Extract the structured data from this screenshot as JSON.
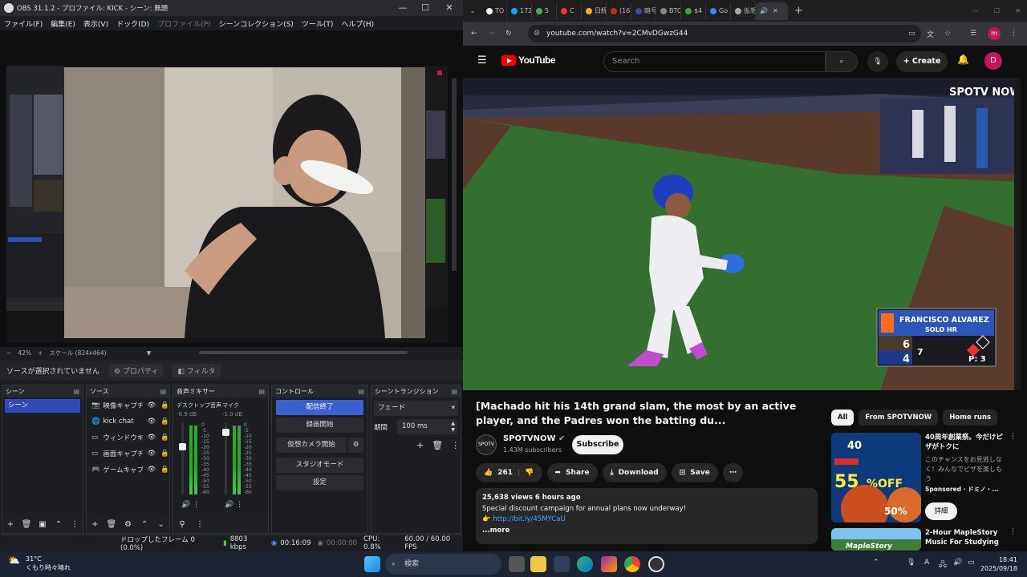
{
  "obs": {
    "title": "OBS 31.1.2 - プロファイル: KICK - シーン: 無題",
    "menu": [
      "ファイル(F)",
      "編集(E)",
      "表示(V)",
      "ドック(D)",
      "プロファイル(P)",
      "シーンコレクション(S)",
      "ツール(T)",
      "ヘルプ(H)"
    ],
    "zoom": "42%",
    "scale": "スケール (824x464)",
    "no_source": "ソースが選択されていません",
    "properties": "プロパティ",
    "filters": "フィルタ",
    "docks": {
      "scenes": "シーン",
      "sources": "ソース",
      "mixer": "音声ミキサー",
      "controls": "コントロール",
      "transitions": "シーントランジション"
    },
    "scene_items": [
      "シーン"
    ],
    "sources": [
      "映像キャプチ",
      "kick chat",
      "ウィンドウキャ",
      "画面キャプチ",
      "ゲームキャプチ"
    ],
    "mixer": [
      {
        "name": "デスクトップ音声",
        "db": "-8.9 dB"
      },
      {
        "name": "マイク",
        "db": "-1.0 dB"
      }
    ],
    "meter_ticks": [
      "0",
      "-5",
      "-10",
      "-15",
      "-20",
      "-25",
      "-30",
      "-35",
      "-40",
      "-45",
      "-50",
      "-55",
      "-60"
    ],
    "controls": [
      "配信終了",
      "録画開始",
      "仮想カメラ開始",
      "スタジオモード",
      "設定"
    ],
    "transition": "フェード",
    "duration_label": "期間",
    "duration": "100 ms",
    "status": {
      "dropped": "ドロップしたフレーム 0 (0.0%)",
      "kbps": "8803 kbps",
      "live": "00:16:09",
      "rec": "00:00:00",
      "cpu": "CPU: 0.8%",
      "fps": "60.00 / 60.00 FPS"
    }
  },
  "chrome": {
    "tabs": [
      "TO",
      "172",
      "5",
      "C",
      "日経",
      "(16",
      "暗号",
      "BTC",
      "$4",
      "Go",
      "仮想",
      ""
    ],
    "url": "youtube.com/watch?v=2CMvDGwzG44",
    "profile": "m"
  },
  "youtube": {
    "logo": "YouTube",
    "search_placeholder": "Search",
    "create": "Create",
    "avatar": "D",
    "title": "[Machado hit his 14th grand slam, the most by an active player, and the Padres won the batting du...",
    "channel": "SPOTVNOW",
    "subs": "1.43M subscribers",
    "subscribe": "Subscribe",
    "likes": "261",
    "share": "Share",
    "download": "Download",
    "save": "Save",
    "desc_stats": "25,638 views  6 hours ago",
    "desc_line": "Special discount campaign for annual plans now underway!",
    "desc_link": "http://bit.ly/45MYCaU",
    "more": "...more",
    "chips": [
      "All",
      "From SPOTVNOW",
      "Home runs"
    ],
    "rec1": {
      "title": "40周年創業祭。今だけピザがトクに",
      "desc": "このチャンスをお見逃しなく！みんなでピザを楽しもう",
      "sponsor": "Sponsored · ドミノ・...",
      "btn": "詳細"
    },
    "rec2": {
      "title": "2-Hour MapleStory Music For Studying"
    },
    "overlay": {
      "brand": "SPOTV NOW",
      "player": "FRANCISCO ALVAREZ",
      "play": "SOLO HR",
      "sd": "6",
      "nym": "4",
      "inning": "7",
      "pitches": "P: 3"
    }
  },
  "taskbar": {
    "temp": "31°C",
    "weather": "くもり時々晴れ",
    "search": "検索",
    "time": "18:41",
    "date": "2025/09/18"
  }
}
